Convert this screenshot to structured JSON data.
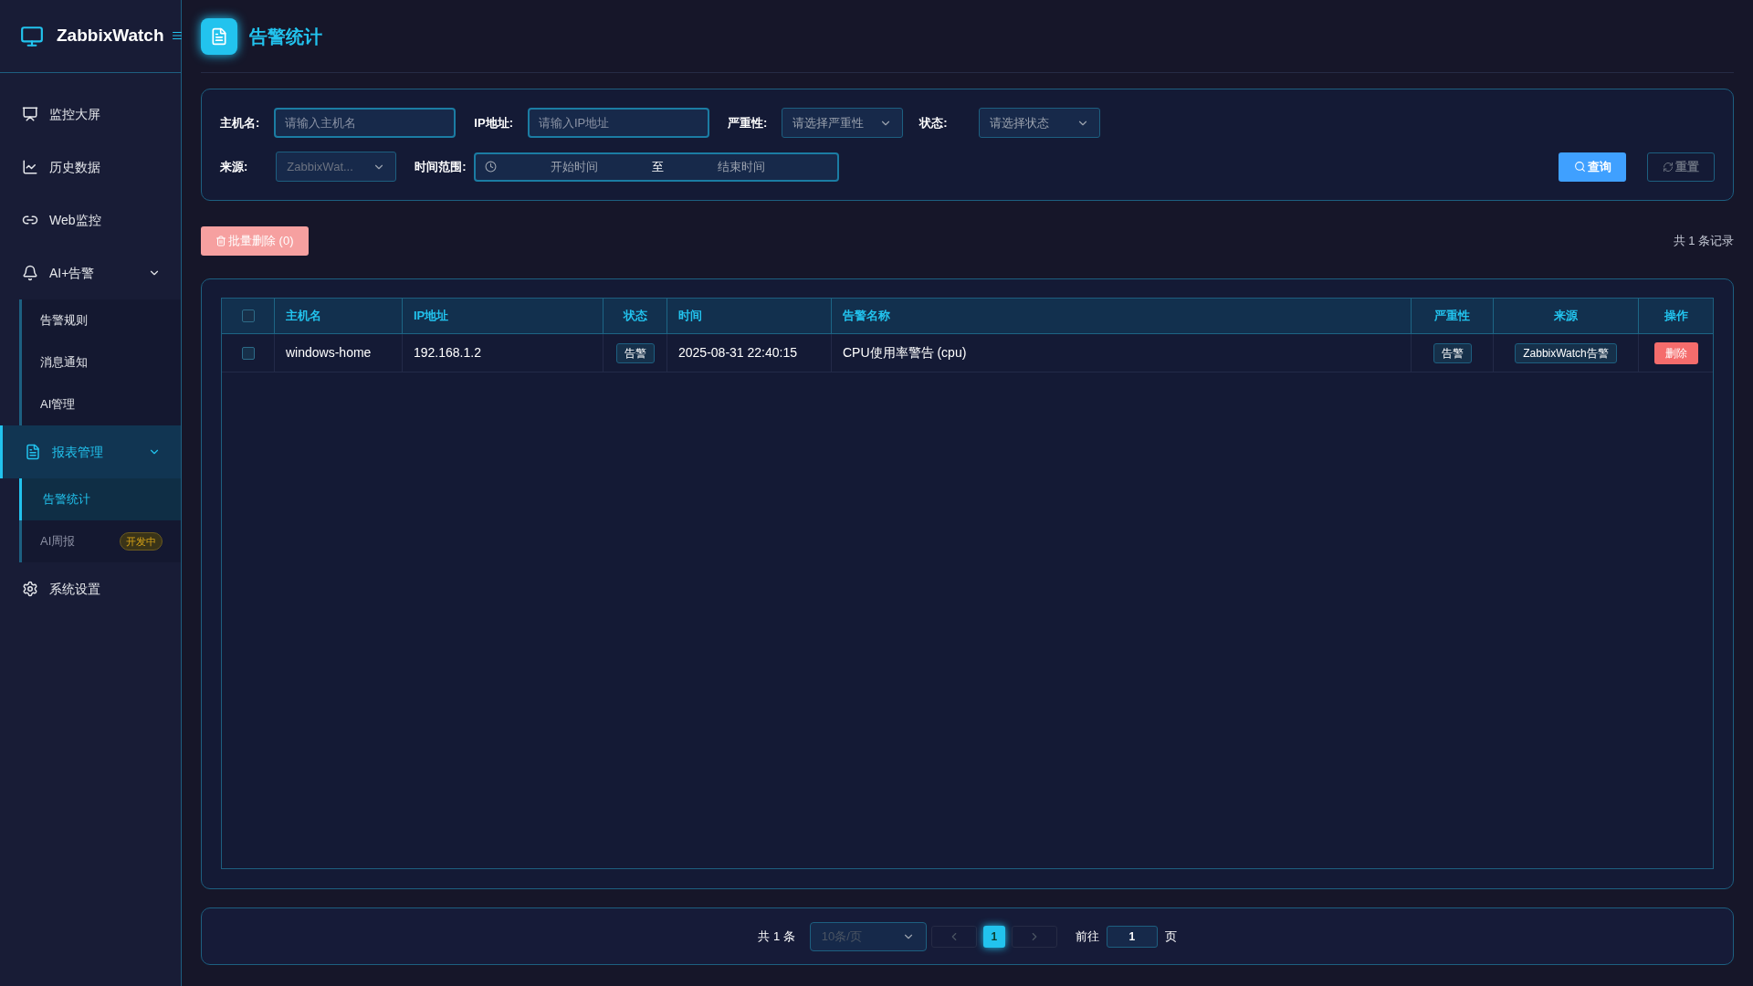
{
  "brand": {
    "name": "ZabbixWatch"
  },
  "sidebar": {
    "items": [
      {
        "label": "监控大屏",
        "selected": false
      },
      {
        "label": "历史数据",
        "selected": false
      },
      {
        "label": "Web监控",
        "selected": false
      },
      {
        "label": "AI+告警",
        "selected": false,
        "expanded": true,
        "children": [
          {
            "label": "告警规则",
            "selected": false,
            "disabled": false
          },
          {
            "label": "消息通知",
            "selected": false,
            "disabled": false
          },
          {
            "label": "AI管理",
            "selected": false,
            "disabled": false
          }
        ]
      },
      {
        "label": "报表管理",
        "selected": true,
        "expanded": true,
        "children": [
          {
            "label": "告警统计",
            "selected": true,
            "disabled": false
          },
          {
            "label": "AI周报",
            "selected": false,
            "disabled": true,
            "badge": "开发中"
          }
        ]
      },
      {
        "label": "系统设置",
        "selected": false
      }
    ]
  },
  "page": {
    "title": "告警统计"
  },
  "filters": {
    "hostname": {
      "label": "主机名:",
      "placeholder": "请输入主机名"
    },
    "ip": {
      "label": "IP地址:",
      "placeholder": "请输入IP地址"
    },
    "severity": {
      "label": "严重性:",
      "placeholder": "请选择严重性"
    },
    "status": {
      "label": "状态:",
      "placeholder": "请选择状态"
    },
    "source": {
      "label": "来源:",
      "value": "ZabbixWat..."
    },
    "time_range": {
      "label": "时间范围:",
      "start_placeholder": "开始时间",
      "separator": "至",
      "end_placeholder": "结束时间"
    },
    "buttons": {
      "query": "查询",
      "reset": "重置"
    }
  },
  "toolbar": {
    "batch_delete": "批量删除 (0)",
    "record_count": "共 1 条记录"
  },
  "table": {
    "columns": [
      "主机名",
      "IP地址",
      "状态",
      "时间",
      "告警名称",
      "严重性",
      "来源",
      "操作"
    ],
    "header_checked": false,
    "rows": [
      {
        "checked": false,
        "hostname": "windows-home",
        "ip": "192.168.1.2",
        "status": "告警",
        "time": "2025-08-31 22:40:15",
        "alert_name": "CPU使用率警告 (cpu)",
        "severity": "告警",
        "source": "ZabbixWatch告警",
        "action": "删除"
      }
    ]
  },
  "pagination": {
    "total": "共 1 条",
    "page_size": "10条/页",
    "pages": [
      {
        "label": "1",
        "selected": true
      }
    ],
    "goto_label": "前往",
    "goto_value": "1",
    "page_suffix": "页"
  }
}
